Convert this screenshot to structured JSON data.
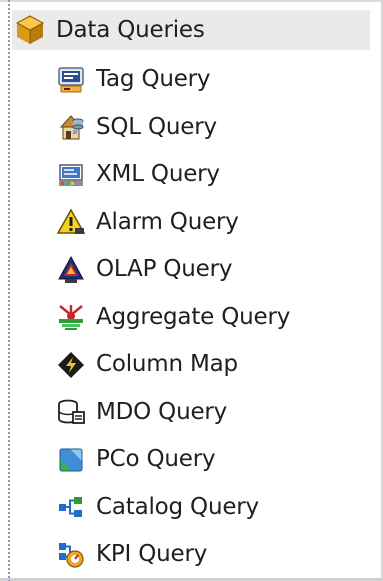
{
  "tree": {
    "root": {
      "label": "Data Queries",
      "icon": "cube-icon"
    },
    "items": [
      {
        "label": "Tag Query",
        "icon": "tag-query-icon"
      },
      {
        "label": "SQL Query",
        "icon": "sql-query-icon"
      },
      {
        "label": "XML Query",
        "icon": "xml-query-icon"
      },
      {
        "label": "Alarm Query",
        "icon": "alarm-query-icon"
      },
      {
        "label": "OLAP Query",
        "icon": "olap-query-icon"
      },
      {
        "label": "Aggregate Query",
        "icon": "aggregate-query-icon"
      },
      {
        "label": "Column Map",
        "icon": "column-map-icon"
      },
      {
        "label": "MDO Query",
        "icon": "mdo-query-icon"
      },
      {
        "label": "PCo Query",
        "icon": "pco-query-icon"
      },
      {
        "label": "Catalog Query",
        "icon": "catalog-query-icon"
      },
      {
        "label": "KPI Query",
        "icon": "kpi-query-icon"
      }
    ]
  },
  "colors": {
    "root_highlight": "#eaeaea",
    "tree_line": "#8a9bb5",
    "text": "#1f1f1f"
  }
}
